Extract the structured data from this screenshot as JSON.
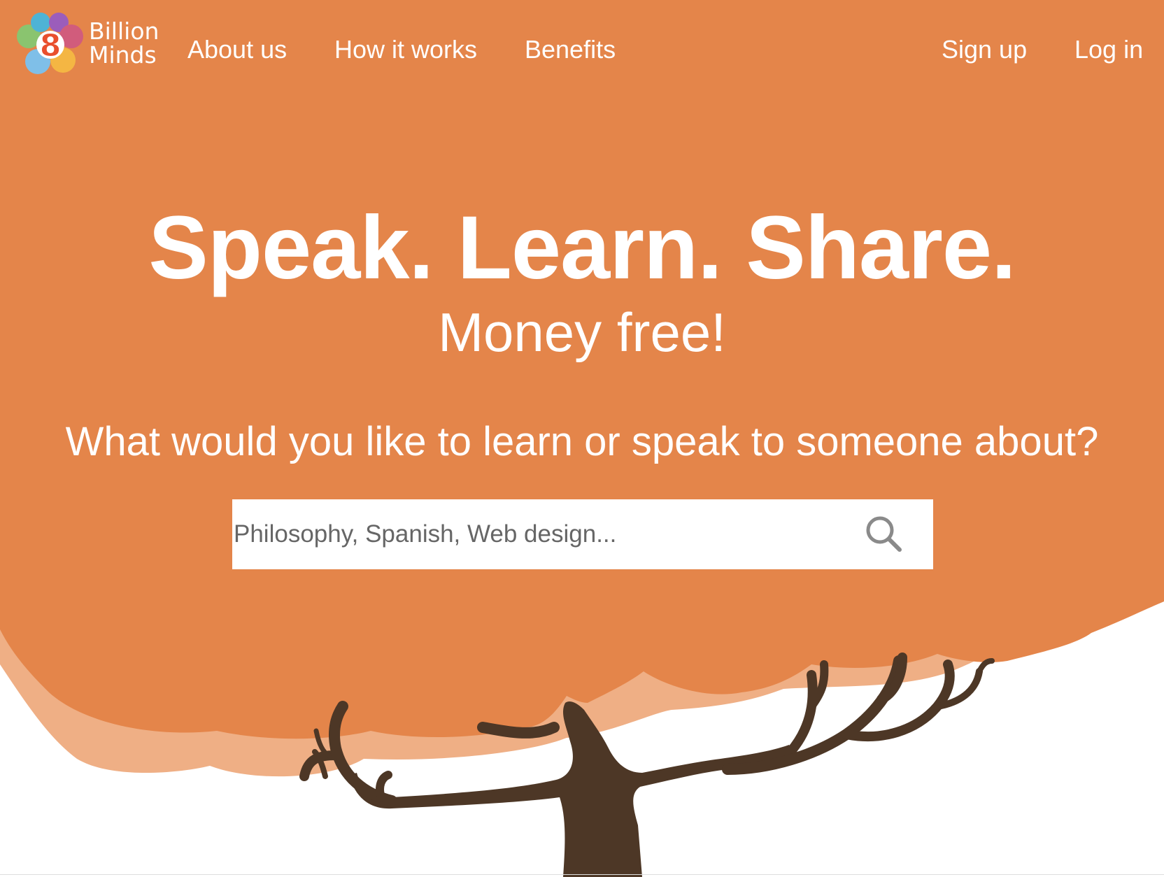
{
  "brand": {
    "logo_digit": "8",
    "name_line1": "Billion",
    "name_line2": "Minds",
    "logo_colors": [
      "#8ac46f",
      "#4eb3d5",
      "#9b5dbb",
      "#d15c7c",
      "#f4b643",
      "#7fbfe8"
    ]
  },
  "nav": {
    "links": [
      {
        "label": "About us"
      },
      {
        "label": "How it works"
      },
      {
        "label": "Benefits"
      }
    ],
    "signup_label": "Sign up",
    "login_label": "Log in"
  },
  "hero": {
    "title": "Speak. Learn. Share.",
    "subtitle": "Money free!",
    "prompt": "What would you like to learn or speak to someone about?"
  },
  "search": {
    "placeholder": "Philosophy, Spanish, Web design...",
    "value": "",
    "icon": "search-icon"
  },
  "colors": {
    "primary_orange": "#e4854a",
    "light_orange": "#efaf85",
    "trunk_brown": "#4d3726",
    "text_white": "#ffffff"
  }
}
